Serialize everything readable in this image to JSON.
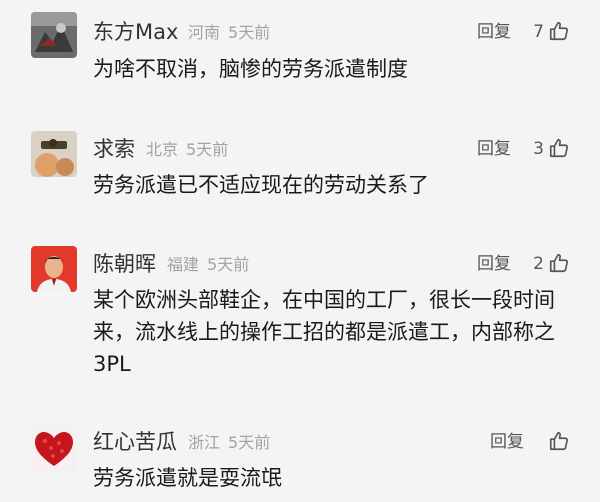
{
  "comments": [
    {
      "username": "东方Max",
      "location": "河南",
      "time": "5天前",
      "reply_label": "回复",
      "likes": "7",
      "text": "为啥不取消，脑惨的劳务派遣制度",
      "avatar_icon": "avatar-image"
    },
    {
      "username": "求索",
      "location": "北京",
      "time": "5天前",
      "reply_label": "回复",
      "likes": "3",
      "text": "劳务派遣已不适应现在的劳动关系了",
      "avatar_icon": "avatar-image"
    },
    {
      "username": "陈朝晖",
      "location": "福建",
      "time": "5天前",
      "reply_label": "回复",
      "likes": "2",
      "text": "某个欧洲头部鞋企，在中国的工厂，很长一段时间来，流水线上的操作工招的都是派遣工，内部称之3PL",
      "avatar_icon": "avatar-portrait"
    },
    {
      "username": "红心苦瓜",
      "location": "浙江",
      "time": "5天前",
      "reply_label": "回复",
      "likes": "",
      "text": "劳务派遣就是耍流氓",
      "avatar_icon": "avatar-heart"
    }
  ],
  "colors": {
    "background": "#f4f4f4",
    "name": "#333333",
    "meta": "#a3a3a3",
    "body": "#1a1a1a",
    "action": "#555555"
  }
}
